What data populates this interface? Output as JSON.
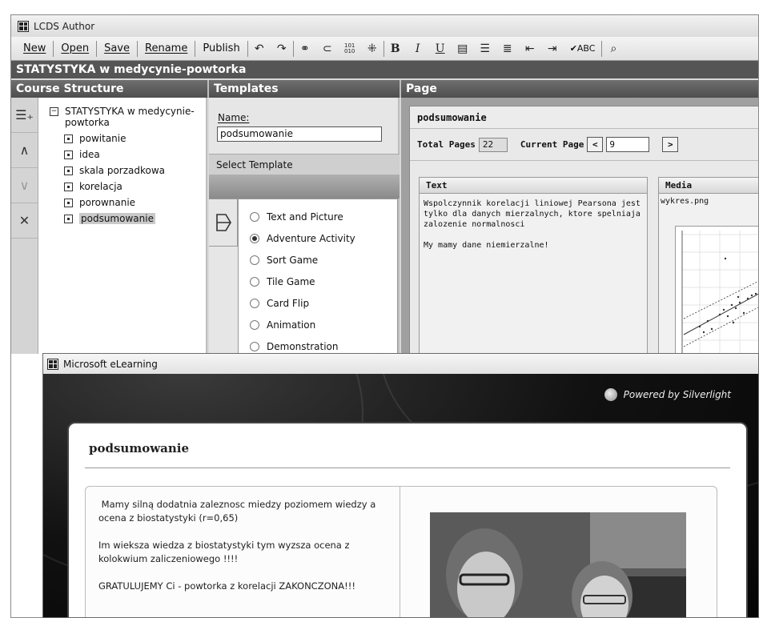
{
  "author_window": {
    "title": "LCDS Author",
    "toolbar": {
      "new": "New",
      "open": "Open",
      "save": "Save",
      "rename": "Rename",
      "publish": "Publish",
      "bold": "B",
      "italic": "I",
      "underline": "U",
      "binary": "101\n010",
      "spell": "✔ABC"
    },
    "course_title": "STATYSTYKA w medycynie-powtorka",
    "panels": {
      "structure": "Course Structure",
      "templates": "Templates",
      "page": "Page"
    },
    "structure": {
      "root": "STATYSTYKA w medycynie-\npowtorka",
      "items": [
        "powitanie",
        "idea",
        "skala porzadkowa",
        "korelacja",
        "porownanie",
        "podsumowanie"
      ]
    },
    "templates": {
      "name_label": "Name:",
      "name_value": "podsumowanie",
      "select_label": "Select Template",
      "options": [
        "Text and Picture",
        "Adventure Activity",
        "Sort Game",
        "Tile Game",
        "Card Flip",
        "Animation",
        "Demonstration"
      ],
      "selected": "Adventure Activity"
    },
    "page": {
      "title": "podsumowanie",
      "total_pages_label": "Total Pages",
      "total_pages": "22",
      "current_page_label": "Current Page",
      "current_page": "9",
      "text_head": "Text",
      "text_body": "Wspolczynnik korelacji liniowej Pearsona jest tylko dla danych mierzalnych, ktore spelniaja zalozenie normalnosci\n\nMy mamy dane niemierzalne!",
      "media_head": "Media",
      "media_file": "wykres.png"
    }
  },
  "elearning_window": {
    "title": "Microsoft eLearning",
    "powered": "Powered by Silverlight",
    "card_title": "podsumowanie",
    "paragraphs": [
      " Mamy silną dodatnia zaleznosc miedzy poziomem wiedzy a ocena z biostatystyki (r=0,65)",
      "Im wieksza wiedza z biostatystyki tym wyzsza ocena z kolokwium zaliczeniowego !!!!",
      "GRATULUJEMY Ci - powtorka z korelacji ZAKONCZONA!!!"
    ]
  }
}
